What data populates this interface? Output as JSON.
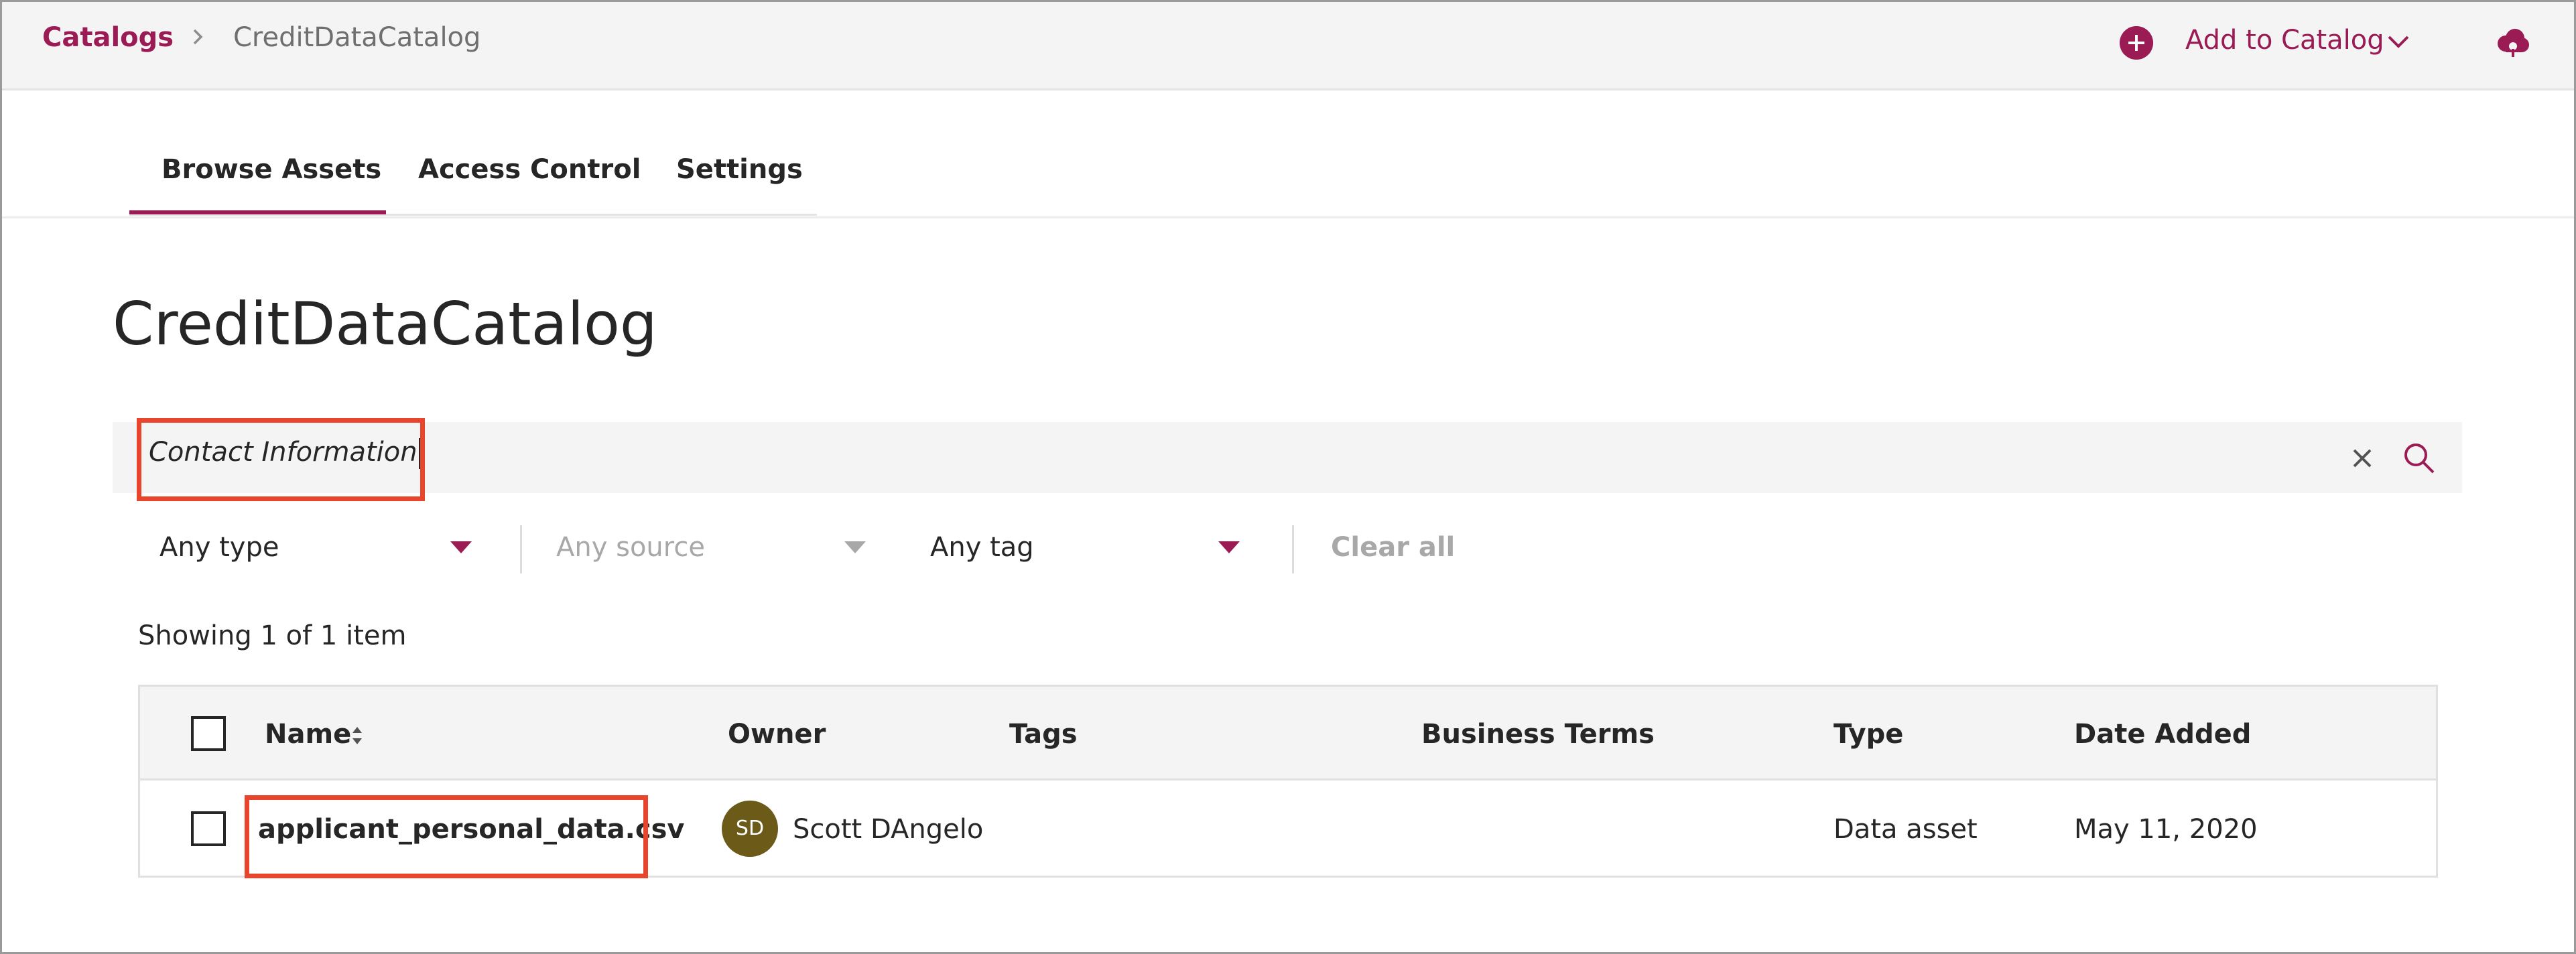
{
  "breadcrumb": {
    "root": "Catalogs",
    "current": "CreditDataCatalog"
  },
  "header": {
    "add_label": "Add to Catalog"
  },
  "tabs": [
    {
      "label": "Browse Assets",
      "active": true
    },
    {
      "label": "Access Control",
      "active": false
    },
    {
      "label": "Settings",
      "active": false
    }
  ],
  "page_title": "CreditDataCatalog",
  "search": {
    "value": "Contact Information"
  },
  "filters": {
    "type": "Any type",
    "source": "Any source",
    "tag": "Any tag",
    "clear_all": "Clear all"
  },
  "results": {
    "showing": "Showing 1 of 1 item"
  },
  "table": {
    "columns": [
      "Name",
      "Owner",
      "Tags",
      "Business Terms",
      "Type",
      "Date Added"
    ],
    "rows": [
      {
        "name": "applicant_personal_data.csv",
        "owner_initials": "SD",
        "owner": "Scott DAngelo",
        "tags": "",
        "business_terms": "",
        "type": "Data asset",
        "date_added": "May 11, 2020"
      }
    ]
  },
  "colors": {
    "accent": "#9b1b54",
    "highlight": "#e8452c",
    "avatar": "#6b5a18"
  },
  "icons": [
    "chevron-right-icon",
    "add-circle-icon",
    "chevron-down-icon",
    "cloud-icon",
    "close-icon",
    "search-icon",
    "caret-down-icon",
    "sort-icon"
  ]
}
